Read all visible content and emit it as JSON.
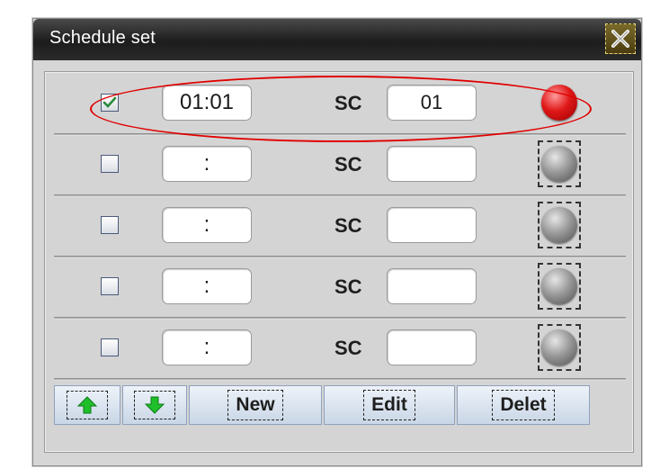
{
  "window": {
    "title": "Schedule set",
    "close_icon": "close-x-icon"
  },
  "rows": [
    {
      "checked": true,
      "time": "01:01",
      "sc_label": "SC",
      "sc_value": "01",
      "status": "active"
    },
    {
      "checked": false,
      "time": ":",
      "sc_label": "SC",
      "sc_value": "",
      "status": "inactive"
    },
    {
      "checked": false,
      "time": ":",
      "sc_label": "SC",
      "sc_value": "",
      "status": "inactive"
    },
    {
      "checked": false,
      "time": ":",
      "sc_label": "SC",
      "sc_value": "",
      "status": "inactive"
    },
    {
      "checked": false,
      "time": ":",
      "sc_label": "SC",
      "sc_value": "",
      "status": "inactive"
    }
  ],
  "toolbar": {
    "up_icon": "arrow-up-icon",
    "down_icon": "arrow-down-icon",
    "new_label": "New",
    "edit_label": "Edit",
    "delete_label": "Delet"
  },
  "colors": {
    "led_on": "#e01818",
    "led_off": "#8a8a8a",
    "arrow_green": "#1fbf2a",
    "annotation_red": "#e00000"
  }
}
